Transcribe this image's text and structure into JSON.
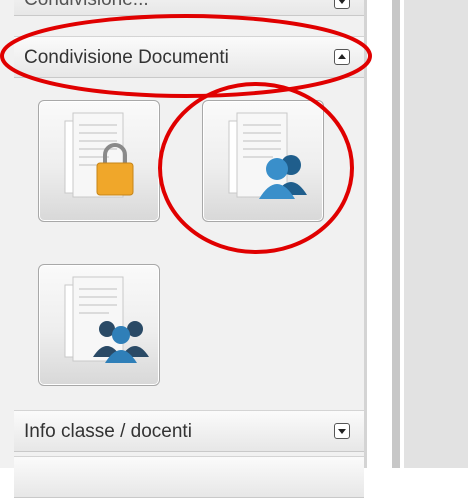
{
  "sections": {
    "top_partial": {
      "label": "Condivisione..."
    },
    "condivisione": {
      "label": "Condivisione Documenti"
    },
    "info": {
      "label": "Info classe / docenti"
    }
  },
  "colors": {
    "annotation_red": "#e00000",
    "lock": "#f0a72a",
    "people": "#2f7fb8",
    "people_dark": "#2a4a66"
  },
  "icons": {
    "tile1": "documents-lock-icon",
    "tile2": "documents-users-icon",
    "tile3": "documents-group-icon"
  }
}
